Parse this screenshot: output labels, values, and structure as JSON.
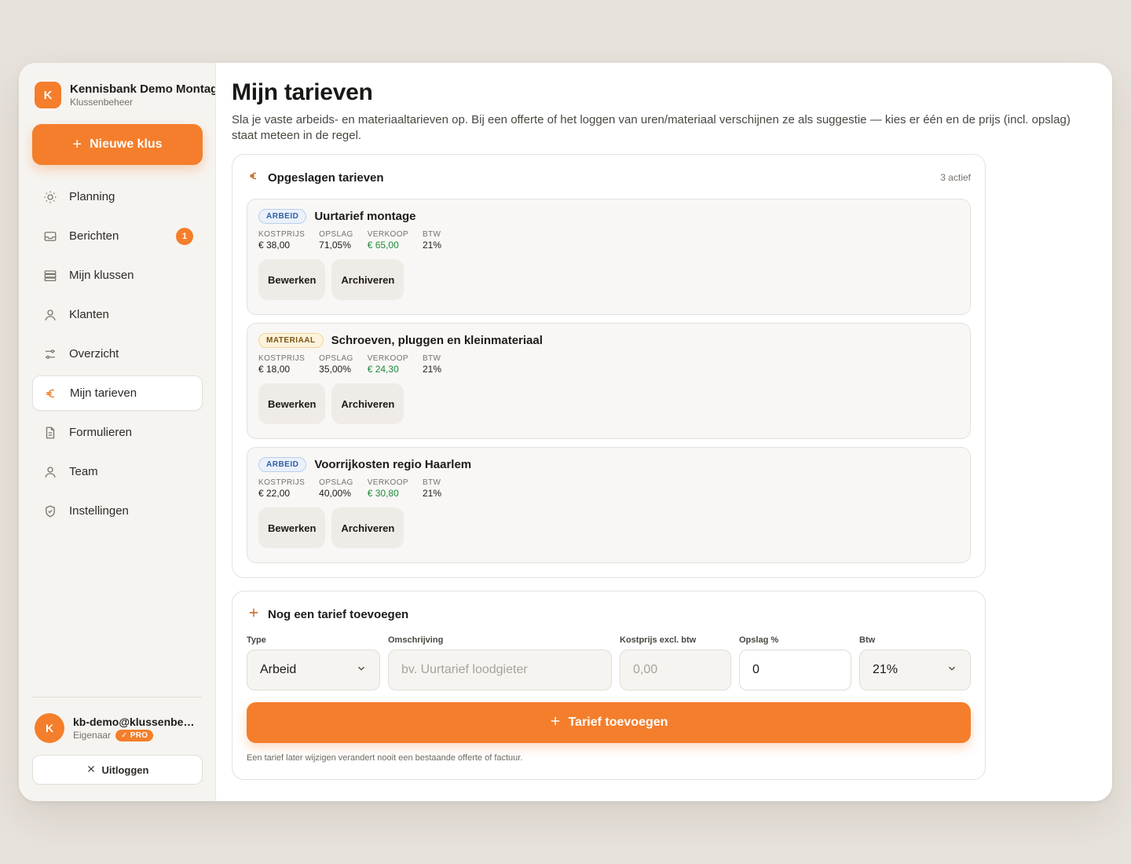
{
  "brand": {
    "initial": "K",
    "name": "Kennisbank Demo Montage",
    "subtitle": "Klussenbeheer"
  },
  "new_job_label": "Nieuwe klus",
  "nav": [
    {
      "label": "Planning",
      "icon": "sun-icon"
    },
    {
      "label": "Berichten",
      "icon": "inbox-icon",
      "badge": "1"
    },
    {
      "label": "Mijn klussen",
      "icon": "stack-icon"
    },
    {
      "label": "Klanten",
      "icon": "user-icon"
    },
    {
      "label": "Overzicht",
      "icon": "sliders-icon"
    },
    {
      "label": "Mijn tarieven",
      "icon": "euro-icon",
      "active": true
    },
    {
      "label": "Formulieren",
      "icon": "document-icon"
    },
    {
      "label": "Team",
      "icon": "user-icon"
    },
    {
      "label": "Instellingen",
      "icon": "shield-icon"
    }
  ],
  "user": {
    "initial": "K",
    "email": "kb-demo@klussenbeheer.nl",
    "role": "Eigenaar",
    "plan": "✓ PRO"
  },
  "logout_label": "Uitloggen",
  "page": {
    "title": "Mijn tarieven",
    "subtitle": "Sla je vaste arbeids- en materiaaltarieven op. Bij een offerte of het loggen van uren/materiaal verschijnen ze als suggestie — kies er één en de prijs (incl. opslag) staat meteen in de regel."
  },
  "saved": {
    "title": "Opgeslagen tarieven",
    "count": "3 actief",
    "labels": {
      "cost": "KOSTPRIJS",
      "markup": "OPSLAG",
      "sale": "VERKOOP",
      "vat": "BTW"
    },
    "edit_label": "Bewerken",
    "archive_label": "Archiveren",
    "rates": [
      {
        "type": "ARBEID",
        "name": "Uurtarief montage",
        "cost": "€ 38,00",
        "markup": "71,05%",
        "sale": "€ 65,00",
        "vat": "21%"
      },
      {
        "type": "MATERIAAL",
        "name": "Schroeven, pluggen en kleinmateriaal",
        "cost": "€ 18,00",
        "markup": "35,00%",
        "sale": "€ 24,30",
        "vat": "21%"
      },
      {
        "type": "ARBEID",
        "name": "Voorrijkosten regio Haarlem",
        "cost": "€ 22,00",
        "markup": "40,00%",
        "sale": "€ 30,80",
        "vat": "21%"
      }
    ]
  },
  "add": {
    "title": "Nog een tarief toevoegen",
    "type_label": "Type",
    "type_value": "Arbeid",
    "desc_label": "Omschrijving",
    "desc_placeholder": "bv. Uurtarief loodgieter",
    "cost_label": "Kostprijs excl. btw",
    "cost_placeholder": "0,00",
    "markup_label": "Opslag %",
    "markup_value": "0",
    "vat_label": "Btw",
    "vat_value": "21%",
    "submit_label": "Tarief toevoegen",
    "hint": "Een tarief later wijzigen verandert nooit een bestaande offerte of factuur."
  },
  "colors": {
    "accent": "#f47e2b",
    "sale": "#1f8a3b",
    "labor_tag": "#2f5ea3",
    "material_tag": "#7a5411"
  }
}
